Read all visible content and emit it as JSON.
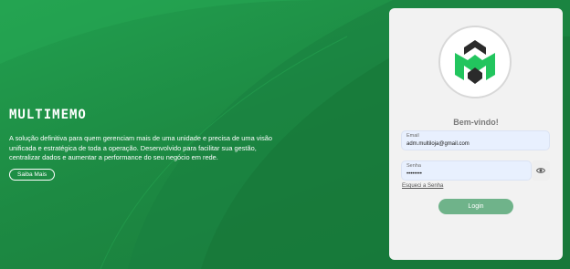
{
  "hero": {
    "brand": "MULTIMEMO",
    "description": "A solução definitiva para quem gerenciam mais de uma unidade e precisa de uma visão unificada e estratégica de toda a operação. Desenvolvido para facilitar sua gestão, centralizar dados e aumentar a performance do seu negócio em rede.",
    "more_button": "Saiba Mais"
  },
  "login": {
    "welcome": "Bem-vindo!",
    "email_label": "Email",
    "email_value": "adm.multiloja@gmail.com",
    "password_label": "Senha",
    "password_value": "••••••••",
    "forgot_link": "Esqueci a Senha",
    "login_button": "Login"
  },
  "colors": {
    "background_green": "#1f8a45",
    "logo_green": "#22c55e",
    "logo_dark": "#2b2b2b",
    "login_button": "#6fb38a",
    "card": "#f2f2f2"
  },
  "icons": {
    "logo": "multimemo-logo-icon",
    "password_toggle": "eye-icon"
  }
}
